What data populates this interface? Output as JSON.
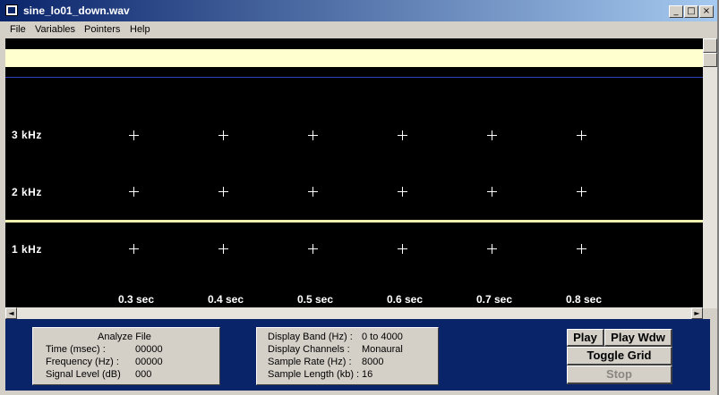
{
  "window": {
    "title": "sine_lo01_down.wav",
    "controls": {
      "minimize": "_",
      "maximize": "□",
      "close": "×"
    }
  },
  "menu": [
    "File",
    "Variables",
    "Pointers",
    "Help"
  ],
  "plot": {
    "freq_labels": [
      "3  kHz",
      "2  kHz",
      "1  kHz"
    ],
    "time_labels": [
      "0.3 sec",
      "0.4 sec",
      "0.5 sec",
      "0.6 sec",
      "0.7 sec",
      "0.8 sec"
    ]
  },
  "analyze": {
    "title": "Analyze File",
    "rows": [
      {
        "label": "Time (msec) :",
        "value": "00000"
      },
      {
        "label": "Frequency (Hz) :",
        "value": "00000"
      },
      {
        "label": "Signal Level (dB)",
        "value": "000"
      }
    ]
  },
  "display": {
    "rows": [
      {
        "label": "Display Band (Hz) :",
        "value": "0 to 4000"
      },
      {
        "label": "Display Channels :",
        "value": "Monaural"
      },
      {
        "label": "Sample Rate (Hz) :",
        "value": "8000"
      },
      {
        "label": "Sample Length (kb) :",
        "value": "16"
      }
    ]
  },
  "buttons": {
    "play": "Play",
    "play_wdw": "Play Wdw",
    "toggle_grid": "Toggle Grid",
    "stop": "Stop"
  },
  "colors": {
    "titlebar_start": "#0a246a",
    "titlebar_end": "#a6caf0",
    "plot_bg": "#000000",
    "highlight_band": "#ffffd0",
    "panel_bg": "#0a246a"
  }
}
